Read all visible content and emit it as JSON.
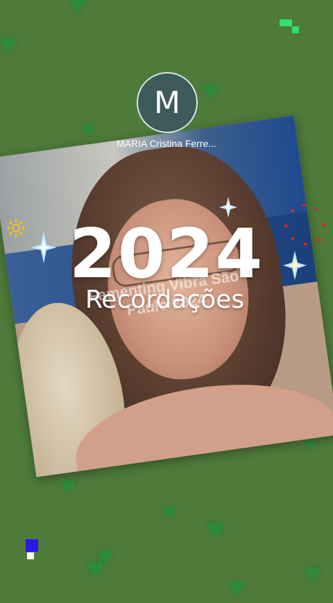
{
  "profile": {
    "initial": "M",
    "name": "MARIA Cristina Ferre..."
  },
  "title": {
    "year": "2024",
    "subtitle": "Recordações"
  },
  "photo_caption": {
    "line1": "Famenting Vibra São",
    "line2": "Paulo 2024"
  },
  "colors": {
    "background": "#4e7a3a",
    "heart": "#2e8b3a",
    "sparkle": "#bfe8ff"
  },
  "icons": {
    "heart": "heart-icon",
    "sparkle": "sparkle-icon",
    "sun": "sun-icon"
  }
}
